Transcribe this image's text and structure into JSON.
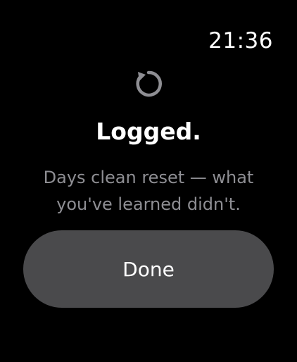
{
  "status_bar": {
    "time": "21:36"
  },
  "icon": {
    "name": "reset-icon",
    "color": "#8e8e93"
  },
  "confirmation": {
    "title": "Logged.",
    "message": "Days clean reset — what you've learned didn't."
  },
  "actions": {
    "done_label": "Done"
  },
  "colors": {
    "background": "#000000",
    "button": "#4a4a4c",
    "secondary_text": "#8e8e93"
  }
}
